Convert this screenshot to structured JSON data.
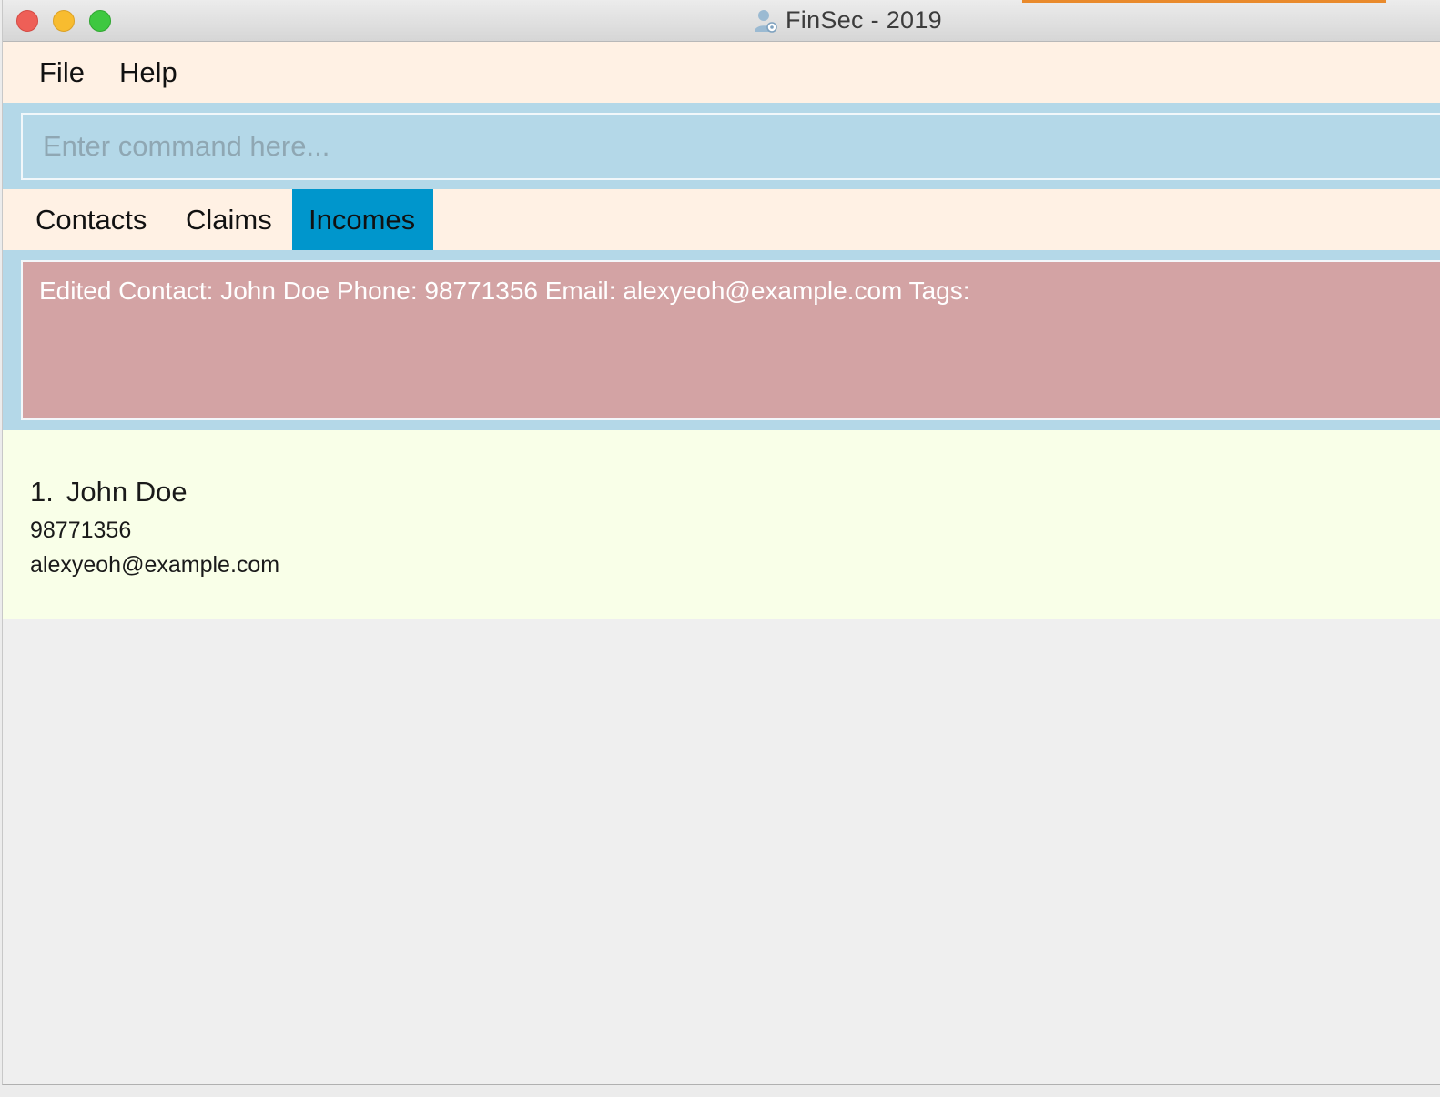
{
  "window": {
    "title": "FinSec - 2019",
    "app_icon": "user-gear-icon"
  },
  "menu": {
    "items": [
      {
        "label": "File"
      },
      {
        "label": "Help"
      }
    ]
  },
  "command": {
    "placeholder": "Enter command here...",
    "value": ""
  },
  "tabs": [
    {
      "label": "Contacts",
      "selected": false
    },
    {
      "label": "Claims",
      "selected": false
    },
    {
      "label": "Incomes",
      "selected": true
    }
  ],
  "result": {
    "message": "Edited Contact: John Doe Phone: 98771356 Email: alexyeoh@example.com Tags:"
  },
  "list": {
    "items": [
      {
        "index": "1.",
        "name": "John Doe",
        "phone": "98771356",
        "email": "alexyeoh@example.com"
      }
    ]
  },
  "colors": {
    "menu_bg": "#fff1e4",
    "command_bg": "#b4d8e8",
    "selected_tab": "#0096cc",
    "result_bg": "#d3a3a4",
    "list_bg": "#f9ffe8"
  }
}
